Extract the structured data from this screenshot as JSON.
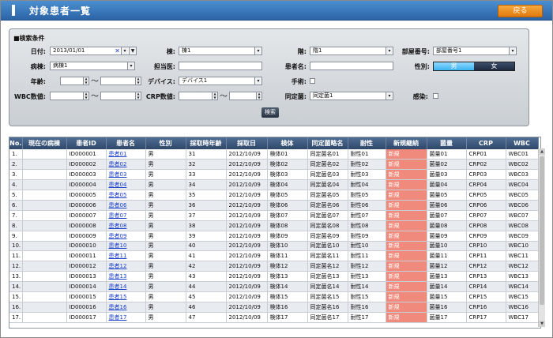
{
  "header": {
    "title": "対象患者一覧",
    "back_label": "戻る"
  },
  "search": {
    "title": "■検索条件",
    "date": {
      "label": "日付:",
      "value": "2013/01/01"
    },
    "ward": {
      "label": "棟:",
      "value": "棟1"
    },
    "floor": {
      "label": "階:",
      "value": "階1"
    },
    "room": {
      "label": "部屋番号:",
      "value": "部屋番号1"
    },
    "ward_disease": {
      "label": "病棟:",
      "value": "病棟1"
    },
    "doctor": {
      "label": "担当医:",
      "value": ""
    },
    "patient_name": {
      "label": "患者名:",
      "value": ""
    },
    "sex": {
      "label": "性別:",
      "male": "男",
      "female": "女",
      "selected": "男"
    },
    "age": {
      "label": "年齢:",
      "from": "",
      "to": ""
    },
    "device": {
      "label": "デバイス:",
      "value": "デバイス1"
    },
    "surgery": {
      "label": "手術:"
    },
    "wbc": {
      "label": "WBC数値:",
      "from": "",
      "to": ""
    },
    "crp": {
      "label": "CRP数値:",
      "from": "",
      "to": ""
    },
    "same_bacteria": {
      "label": "同定菌:",
      "value": "同定菌1"
    },
    "infection": {
      "label": "感染:"
    },
    "search_label": "検索",
    "tilde": "〜"
  },
  "table": {
    "headers": [
      "No.",
      "現在の病棟",
      "患者ID",
      "患者名",
      "性別",
      "採取時年齢",
      "採取日",
      "検体",
      "同定菌略名",
      "耐性",
      "新規継続",
      "菌量",
      "CRP",
      "WBC"
    ],
    "rows": [
      [
        "1.",
        "",
        "ID000001",
        "患者01",
        "男",
        "31",
        "2012/10/09",
        "検体01",
        "同定菌名01",
        "耐性01",
        "新規",
        "菌量01",
        "CRP01",
        "WBC01"
      ],
      [
        "2.",
        "",
        "ID000002",
        "患者02",
        "男",
        "32",
        "2012/10/09",
        "検体02",
        "同定菌名02",
        "耐性02",
        "新規",
        "菌量02",
        "CRP02",
        "WBC02"
      ],
      [
        "3.",
        "",
        "ID000003",
        "患者03",
        "男",
        "33",
        "2012/10/09",
        "検体03",
        "同定菌名03",
        "耐性03",
        "新規",
        "菌量03",
        "CRP03",
        "WBC03"
      ],
      [
        "4.",
        "",
        "ID000004",
        "患者04",
        "男",
        "34",
        "2012/10/09",
        "検体04",
        "同定菌名04",
        "耐性04",
        "新規",
        "菌量04",
        "CRP04",
        "WBC04"
      ],
      [
        "5.",
        "",
        "ID000005",
        "患者05",
        "男",
        "35",
        "2012/10/09",
        "検体05",
        "同定菌名05",
        "耐性05",
        "新規",
        "菌量05",
        "CRP05",
        "WBC05"
      ],
      [
        "6.",
        "",
        "ID000006",
        "患者06",
        "男",
        "36",
        "2012/10/09",
        "検体06",
        "同定菌名06",
        "耐性06",
        "新規",
        "菌量06",
        "CRP06",
        "WBC06"
      ],
      [
        "7.",
        "",
        "ID000007",
        "患者07",
        "男",
        "37",
        "2012/10/09",
        "検体07",
        "同定菌名07",
        "耐性07",
        "新規",
        "菌量07",
        "CRP07",
        "WBC07"
      ],
      [
        "8.",
        "",
        "ID000008",
        "患者08",
        "男",
        "38",
        "2012/10/09",
        "検体08",
        "同定菌名08",
        "耐性08",
        "新規",
        "菌量08",
        "CRP08",
        "WBC08"
      ],
      [
        "9.",
        "",
        "ID000009",
        "患者09",
        "男",
        "39",
        "2012/10/09",
        "検体09",
        "同定菌名09",
        "耐性09",
        "新規",
        "菌量09",
        "CRP09",
        "WBC09"
      ],
      [
        "10.",
        "",
        "ID000010",
        "患者10",
        "男",
        "40",
        "2012/10/09",
        "検体10",
        "同定菌名10",
        "耐性10",
        "新規",
        "菌量10",
        "CRP10",
        "WBC10"
      ],
      [
        "11.",
        "",
        "ID000011",
        "患者11",
        "男",
        "41",
        "2012/10/09",
        "検体11",
        "同定菌名11",
        "耐性11",
        "新規",
        "菌量11",
        "CRP11",
        "WBC11"
      ],
      [
        "12.",
        "",
        "ID000012",
        "患者12",
        "男",
        "42",
        "2012/10/09",
        "検体12",
        "同定菌名12",
        "耐性12",
        "新規",
        "菌量12",
        "CRP12",
        "WBC12"
      ],
      [
        "13.",
        "",
        "ID000013",
        "患者13",
        "男",
        "43",
        "2012/10/09",
        "検体13",
        "同定菌名13",
        "耐性13",
        "新規",
        "菌量13",
        "CRP13",
        "WBC13"
      ],
      [
        "14.",
        "",
        "ID000014",
        "患者14",
        "男",
        "44",
        "2012/10/09",
        "検体14",
        "同定菌名14",
        "耐性14",
        "新規",
        "菌量14",
        "CRP14",
        "WBC14"
      ],
      [
        "15.",
        "",
        "ID000015",
        "患者15",
        "男",
        "45",
        "2012/10/09",
        "検体15",
        "同定菌名15",
        "耐性15",
        "新規",
        "菌量15",
        "CRP15",
        "WBC15"
      ],
      [
        "16.",
        "",
        "ID000016",
        "患者16",
        "男",
        "46",
        "2012/10/09",
        "検体16",
        "同定菌名16",
        "耐性16",
        "新規",
        "菌量16",
        "CRP16",
        "WBC16"
      ],
      [
        "17.",
        "",
        "ID000017",
        "患者17",
        "男",
        "47",
        "2012/10/09",
        "検体17",
        "同定菌名17",
        "耐性17",
        "新規",
        "菌量17",
        "CRP17",
        "WBC17"
      ]
    ]
  },
  "colors": {
    "header": "#2c64a6",
    "back_button": "#e88a17",
    "new_cell": "#f08a7c",
    "link": "#1a3fc8"
  }
}
